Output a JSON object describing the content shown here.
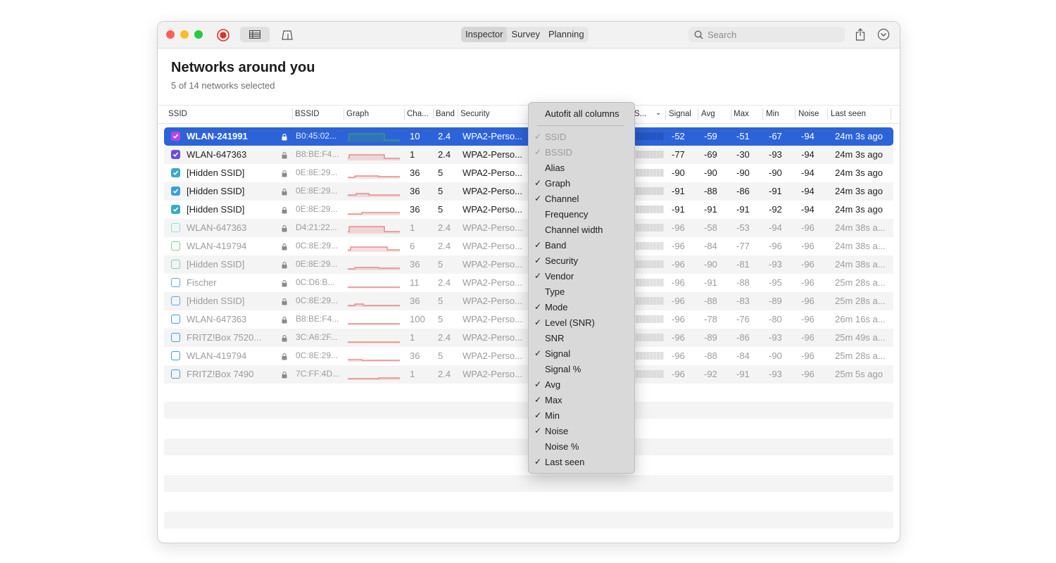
{
  "toolbar": {
    "tabs": [
      {
        "label": "Inspector",
        "active": true
      },
      {
        "label": "Survey",
        "active": false
      },
      {
        "label": "Planning",
        "active": false
      }
    ],
    "search_placeholder": "Search",
    "icons": [
      "record-icon",
      "table-view-icon",
      "floor-plan-icon",
      "share-icon",
      "chevron-down-circle-icon",
      "search-icon"
    ]
  },
  "page": {
    "title": "Networks around you",
    "subtitle": "5 of 14 networks selected"
  },
  "columns": {
    "ssid": "SSID",
    "bssid": "BSSID",
    "graph": "Graph",
    "channel": "Cha...",
    "band": "Band",
    "security": "Security",
    "level": "S...",
    "signal": "Signal",
    "avg": "Avg",
    "max": "Max",
    "min": "Min",
    "noise": "Noise",
    "last_seen": "Last seen"
  },
  "networks": [
    {
      "ssid": "WLAN-241991",
      "bssid": "B0:45:02...",
      "channel": "10",
      "band": "2.4",
      "security": "WPA2-Perso...",
      "signal": "-52",
      "avg": "-59",
      "max": "-51",
      "min": "-67",
      "noise": "-94",
      "last_seen": "24m 3s ago",
      "checked": true,
      "color": "#c040e8",
      "selected": true,
      "dim": false,
      "graph_color": "#3aa36a"
    },
    {
      "ssid": "WLAN-647363",
      "bssid": "B8:BE:F4...",
      "channel": "1",
      "band": "2.4",
      "security": "WPA2-Perso...",
      "signal": "-77",
      "avg": "-69",
      "max": "-30",
      "min": "-93",
      "noise": "-94",
      "last_seen": "24m 3s ago",
      "checked": true,
      "color": "#6a4fe0",
      "selected": false,
      "dim": false,
      "graph_color": "#e07a7a"
    },
    {
      "ssid": "[Hidden SSID]",
      "bssid": "0E:8E:29...",
      "channel": "36",
      "band": "5",
      "security": "WPA2-Perso...",
      "signal": "-90",
      "avg": "-90",
      "max": "-90",
      "min": "-90",
      "noise": "-94",
      "last_seen": "24m 3s ago",
      "checked": true,
      "color": "#3aa8c8",
      "selected": false,
      "dim": false,
      "graph_color": "#e07a7a"
    },
    {
      "ssid": "[Hidden SSID]",
      "bssid": "0E:8E:29...",
      "channel": "36",
      "band": "5",
      "security": "WPA2-Perso...",
      "signal": "-91",
      "avg": "-88",
      "max": "-86",
      "min": "-91",
      "noise": "-94",
      "last_seen": "24m 3s ago",
      "checked": true,
      "color": "#3a9fd8",
      "selected": false,
      "dim": false,
      "graph_color": "#e07a7a"
    },
    {
      "ssid": "[Hidden SSID]",
      "bssid": "0E:8E:29...",
      "channel": "36",
      "band": "5",
      "security": "WPA2-Perso...",
      "signal": "-91",
      "avg": "-91",
      "max": "-91",
      "min": "-92",
      "noise": "-94",
      "last_seen": "24m 3s ago",
      "checked": true,
      "color": "#3aa8c8",
      "selected": false,
      "dim": false,
      "graph_color": "#e07a7a"
    },
    {
      "ssid": "WLAN-647363",
      "bssid": "D4:21:22...",
      "channel": "1",
      "band": "2.4",
      "security": "WPA2-Perso...",
      "signal": "-96",
      "avg": "-58",
      "max": "-53",
      "min": "-94",
      "noise": "-96",
      "last_seen": "24m 38s a...",
      "checked": false,
      "color": "#8fe0e0",
      "selected": false,
      "dim": true,
      "graph_color": "#e07a7a"
    },
    {
      "ssid": "WLAN-419794",
      "bssid": "0C:8E:29...",
      "channel": "6",
      "band": "2.4",
      "security": "WPA2-Perso...",
      "signal": "-96",
      "avg": "-84",
      "max": "-77",
      "min": "-96",
      "noise": "-96",
      "last_seen": "24m 38s a...",
      "checked": false,
      "color": "#7ccf8a",
      "selected": false,
      "dim": true,
      "graph_color": "#e07a7a"
    },
    {
      "ssid": "[Hidden SSID]",
      "bssid": "0E:8E:29...",
      "channel": "36",
      "band": "5",
      "security": "WPA2-Perso...",
      "signal": "-96",
      "avg": "-90",
      "max": "-81",
      "min": "-93",
      "noise": "-96",
      "last_seen": "24m 38s a...",
      "checked": false,
      "color": "#7ccfc0",
      "selected": false,
      "dim": true,
      "graph_color": "#e07a7a"
    },
    {
      "ssid": "Fischer",
      "bssid": "0C:D6:B...",
      "channel": "11",
      "band": "2.4",
      "security": "WPA2-Perso...",
      "signal": "-96",
      "avg": "-91",
      "max": "-88",
      "min": "-95",
      "noise": "-96",
      "last_seen": "25m 28s a...",
      "checked": false,
      "color": "#5aa8e0",
      "selected": false,
      "dim": true,
      "graph_color": "#e07a7a"
    },
    {
      "ssid": "[Hidden SSID]",
      "bssid": "0C:8E:29...",
      "channel": "36",
      "band": "5",
      "security": "WPA2-Perso...",
      "signal": "-96",
      "avg": "-88",
      "max": "-83",
      "min": "-89",
      "noise": "-96",
      "last_seen": "25m 28s a...",
      "checked": false,
      "color": "#5aa8e0",
      "selected": false,
      "dim": true,
      "graph_color": "#e07a7a"
    },
    {
      "ssid": "WLAN-647363",
      "bssid": "B8:BE:F4...",
      "channel": "100",
      "band": "5",
      "security": "WPA2-Perso...",
      "signal": "-96",
      "avg": "-78",
      "max": "-76",
      "min": "-80",
      "noise": "-96",
      "last_seen": "26m 16s a...",
      "checked": false,
      "color": "#3a9fd8",
      "selected": false,
      "dim": true,
      "graph_color": "#e07a7a"
    },
    {
      "ssid": "FRITZ!Box 7520...",
      "bssid": "3C:A6:2F...",
      "channel": "1",
      "band": "2.4",
      "security": "WPA2-Perso...",
      "signal": "-96",
      "avg": "-89",
      "max": "-86",
      "min": "-93",
      "noise": "-96",
      "last_seen": "25m 49s a...",
      "checked": false,
      "color": "#3a9fd8",
      "selected": false,
      "dim": true,
      "graph_color": "#e07a7a"
    },
    {
      "ssid": "WLAN-419794",
      "bssid": "0C:8E:29...",
      "channel": "36",
      "band": "5",
      "security": "WPA2-Perso...",
      "signal": "-96",
      "avg": "-88",
      "max": "-84",
      "min": "-90",
      "noise": "-96",
      "last_seen": "25m 28s a...",
      "checked": false,
      "color": "#3a9fd8",
      "selected": false,
      "dim": true,
      "graph_color": "#e07a7a"
    },
    {
      "ssid": "FRITZ!Box 7490",
      "bssid": "7C:FF:4D...",
      "channel": "1",
      "band": "2.4",
      "security": "WPA2-Perso...",
      "signal": "-96",
      "avg": "-92",
      "max": "-91",
      "min": "-93",
      "noise": "-96",
      "last_seen": "25m 5s ago",
      "checked": false,
      "color": "#3a9fd8",
      "selected": false,
      "dim": true,
      "graph_color": "#e07a7a"
    }
  ],
  "column_menu": {
    "autofit": "Autofit all columns",
    "items": [
      {
        "label": "SSID",
        "checked": true,
        "disabled": true
      },
      {
        "label": "BSSID",
        "checked": true,
        "disabled": true
      },
      {
        "label": "Alias",
        "checked": false,
        "disabled": false
      },
      {
        "label": "Graph",
        "checked": true,
        "disabled": false
      },
      {
        "label": "Channel",
        "checked": true,
        "disabled": false
      },
      {
        "label": "Frequency",
        "checked": false,
        "disabled": false
      },
      {
        "label": "Channel width",
        "checked": false,
        "disabled": false
      },
      {
        "label": "Band",
        "checked": true,
        "disabled": false
      },
      {
        "label": "Security",
        "checked": true,
        "disabled": false
      },
      {
        "label": "Vendor",
        "checked": true,
        "disabled": false
      },
      {
        "label": "Type",
        "checked": false,
        "disabled": false
      },
      {
        "label": "Mode",
        "checked": true,
        "disabled": false
      },
      {
        "label": "Level (SNR)",
        "checked": true,
        "disabled": false
      },
      {
        "label": "SNR",
        "checked": false,
        "disabled": false
      },
      {
        "label": "Signal",
        "checked": true,
        "disabled": false
      },
      {
        "label": "Signal %",
        "checked": false,
        "disabled": false
      },
      {
        "label": "Avg",
        "checked": true,
        "disabled": false
      },
      {
        "label": "Max",
        "checked": true,
        "disabled": false
      },
      {
        "label": "Min",
        "checked": true,
        "disabled": false
      },
      {
        "label": "Noise",
        "checked": true,
        "disabled": false
      },
      {
        "label": "Noise %",
        "checked": false,
        "disabled": false
      },
      {
        "label": "Last seen",
        "checked": true,
        "disabled": false
      }
    ],
    "check_glyph": "✓"
  },
  "colors": {
    "selection": "#2d63d8",
    "traffic_red": "#ff5f57",
    "traffic_yellow": "#febc2e",
    "traffic_green": "#28c840",
    "record_red": "#e0302a"
  }
}
